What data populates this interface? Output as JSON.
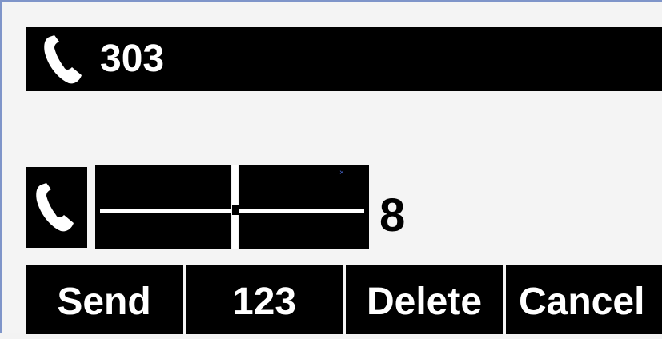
{
  "call_bar": {
    "number": "303",
    "icon": "phone-handset-icon"
  },
  "dial_line": {
    "icon": "phone-handset-icon",
    "typed_digit": "8"
  },
  "softkeys": {
    "send": "Send",
    "mode": "123",
    "delete": "Delete",
    "cancel": "Cancel"
  },
  "colors": {
    "background": "#f4f4f4",
    "bar": "#000000",
    "text_inverse": "#ffffff",
    "frame": "#7f95c9"
  }
}
